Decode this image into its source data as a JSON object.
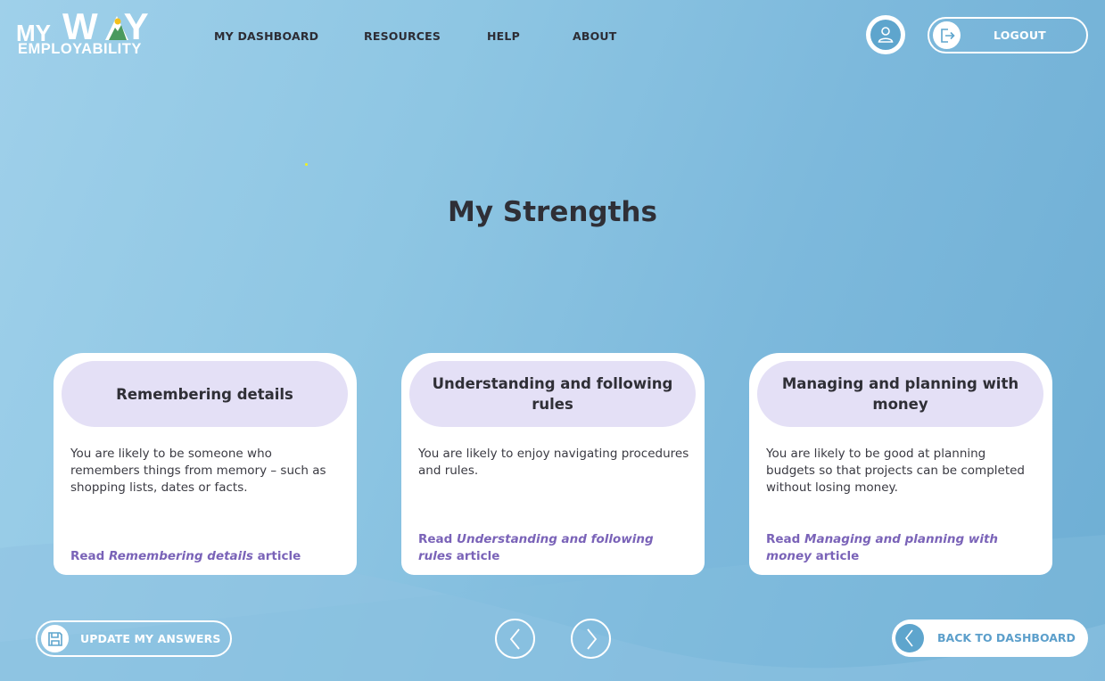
{
  "brand": {
    "logo_my": "MY",
    "logo_way": "W",
    "logo_way_end": "Y",
    "logo_sub": "EMPLOYABILITY"
  },
  "nav": {
    "items": [
      {
        "label": "MY DASHBOARD"
      },
      {
        "label": "RESOURCES"
      },
      {
        "label": "HELP"
      },
      {
        "label": "ABOUT"
      }
    ]
  },
  "header": {
    "profile_icon": "user-icon",
    "logout_label": "LOGOUT",
    "logout_icon": "logout-icon"
  },
  "page": {
    "title": "My Strengths"
  },
  "cards": [
    {
      "title": "Remembering details",
      "description": "You are likely to be someone who remembers things from memory – such as shopping lists, dates or facts.",
      "link_prefix": "Read ",
      "link_topic": "Remembering details",
      "link_suffix": " article"
    },
    {
      "title": "Understanding and following rules",
      "description": "You are likely to enjoy navigating procedures and rules.",
      "link_prefix": "Read ",
      "link_topic": "Understanding and following rules",
      "link_suffix": " article"
    },
    {
      "title": "Managing and planning with money",
      "description": "You are likely to be good at planning budgets so that projects can be completed without losing money.",
      "link_prefix": "Read ",
      "link_topic": "Managing and planning with money",
      "link_suffix": " article"
    }
  ],
  "footer": {
    "update_label": "UPDATE MY ANSWERS",
    "update_icon": "save-icon",
    "prev_icon": "chevron-left-icon",
    "next_icon": "chevron-right-icon",
    "back_label": "BACK TO DASHBOARD",
    "back_icon": "chevron-left-icon"
  },
  "colors": {
    "accent_blue": "#5ea5cd",
    "card_header": "#e4e0f6",
    "link_purple": "#7a63b8",
    "text_dark": "#2f2f36",
    "logo_green": "#4a9a5e",
    "logo_sun": "#f4c01e"
  }
}
